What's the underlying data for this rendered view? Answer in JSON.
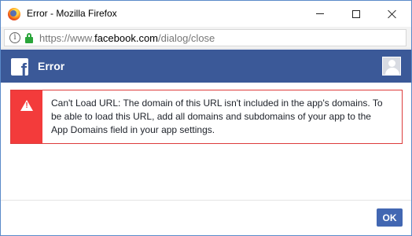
{
  "window": {
    "title": "Error - Mozilla Firefox",
    "icon": "firefox-icon"
  },
  "urlbar": {
    "prefix": "https://www.",
    "domain": "facebook.com",
    "path": "/dialog/close",
    "icons": [
      "info-icon",
      "lock-icon"
    ]
  },
  "dialog": {
    "title": "Error",
    "icon": "facebook-logo-icon"
  },
  "error": {
    "icon": "warning-icon",
    "line1": "Can't Load URL: The domain of this URL isn't included in the app's domains. To",
    "line2": "be able to load this URL, add all domains and subdomains of your app to the",
    "line3": "App Domains field in your app settings."
  },
  "footer": {
    "ok_label": "OK"
  },
  "colors": {
    "fb_blue": "#3b5998",
    "error_red": "#f33b3b",
    "button_blue": "#4267b2"
  }
}
